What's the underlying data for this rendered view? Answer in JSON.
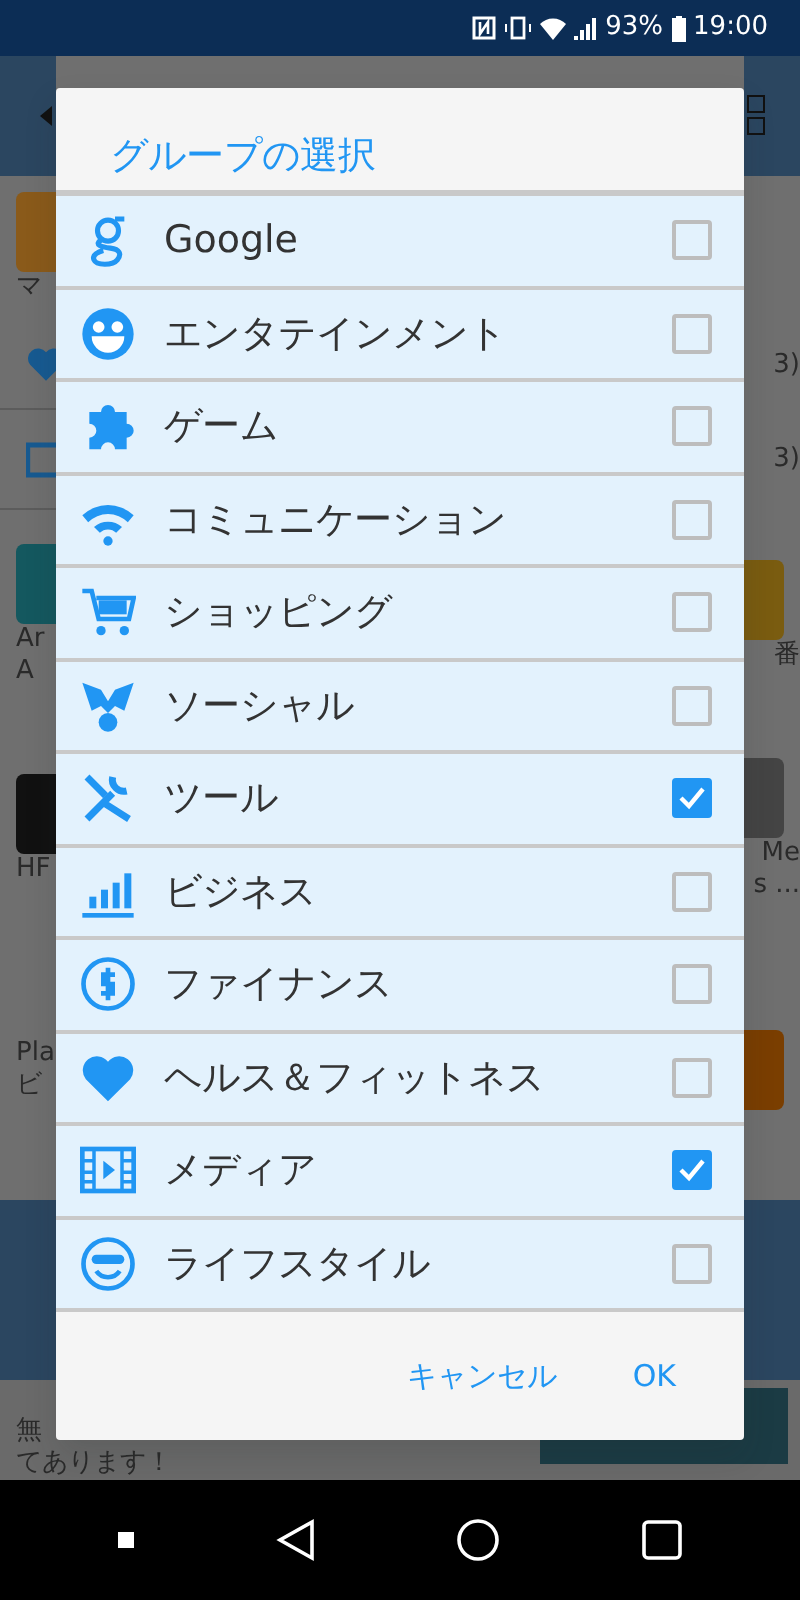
{
  "status_bar": {
    "battery": "93%",
    "time": "19:00"
  },
  "background": {
    "left": [
      {
        "kind": "appbar-back"
      },
      {
        "kind": "tile",
        "text": "マ"
      },
      {
        "kind": "heart"
      },
      {
        "kind": "film"
      },
      {
        "kind": "tile",
        "text": "Ar",
        "text2": "A"
      },
      {
        "kind": "tile",
        "text": "HF"
      },
      {
        "kind": "text",
        "text": "Pla",
        "text2": "ビ"
      },
      {
        "kind": "band"
      }
    ],
    "right": [
      {
        "kind": "appbar-icon"
      },
      {
        "kind": "blank"
      },
      {
        "kind": "text",
        "text": "3)"
      },
      {
        "kind": "text",
        "text": "3)"
      },
      {
        "kind": "tile",
        "text": "番"
      },
      {
        "kind": "tile",
        "text": "Me",
        "text2": "s ..."
      },
      {
        "kind": "tile"
      },
      {
        "kind": "band"
      }
    ],
    "ad": {
      "line1": "無",
      "line2": "てあります！"
    }
  },
  "dialog": {
    "title": "グループの選択",
    "items": [
      {
        "label": "Google",
        "checked": false
      },
      {
        "label": "エンタテインメント",
        "checked": false
      },
      {
        "label": "ゲーム",
        "checked": false
      },
      {
        "label": "コミュニケーション",
        "checked": false
      },
      {
        "label": "ショッピング",
        "checked": false
      },
      {
        "label": "ソーシャル",
        "checked": false
      },
      {
        "label": "ツール",
        "checked": true
      },
      {
        "label": "ビジネス",
        "checked": false
      },
      {
        "label": "ファイナンス",
        "checked": false
      },
      {
        "label": "ヘルス＆フィットネス",
        "checked": false
      },
      {
        "label": "メディア",
        "checked": true
      },
      {
        "label": "ライフスタイル",
        "checked": false
      }
    ],
    "buttons": [
      "キャンセル",
      "OK"
    ]
  }
}
